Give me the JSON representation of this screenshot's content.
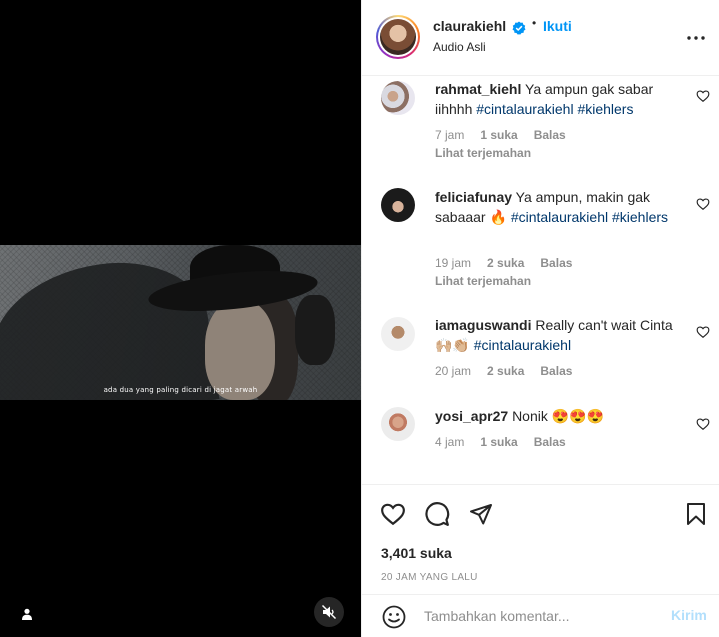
{
  "video": {
    "subtitle": "ada dua yang paling dicari di jagat arwah"
  },
  "header": {
    "username": "claurakiehl",
    "separator": "•",
    "follow_label": "Ikuti",
    "audio_label": "Audio Asli"
  },
  "comments": [
    {
      "username": "rahmat_kiehl",
      "text": "Ya ampun gak sabar iihhhh",
      "tags": "#cintalaurakiehl #kiehlers",
      "time": "7 jam",
      "likes": "1 suka",
      "reply": "Balas",
      "translate": "Lihat terjemahan"
    },
    {
      "username": "feliciafunay",
      "text": "Ya ampun, makin gak sabaaar 🔥",
      "tags": "#cintalaurakiehl #kiehlers",
      "time": "19 jam",
      "likes": "2 suka",
      "reply": "Balas",
      "translate": "Lihat terjemahan"
    },
    {
      "username": "iamaguswandi",
      "text": "Really can't wait Cinta🙌🏼👏🏼",
      "tags": "#cintalaurakiehl",
      "time": "20 jam",
      "likes": "2 suka",
      "reply": "Balas"
    },
    {
      "username": "yosi_apr27",
      "text": "Nonik 😍😍😍",
      "time": "4 jam",
      "likes": "1 suka",
      "reply": "Balas"
    }
  ],
  "post": {
    "likes": "3,401 suka",
    "time_ago": "20 JAM YANG LALU"
  },
  "composer": {
    "placeholder": "Tambahkan komentar...",
    "send_label": "Kirim"
  },
  "colors": {
    "accent": "#0095f6",
    "send_disabled": "#b2dffc",
    "hashtag": "#00376b",
    "muted": "#8e8e8e"
  }
}
